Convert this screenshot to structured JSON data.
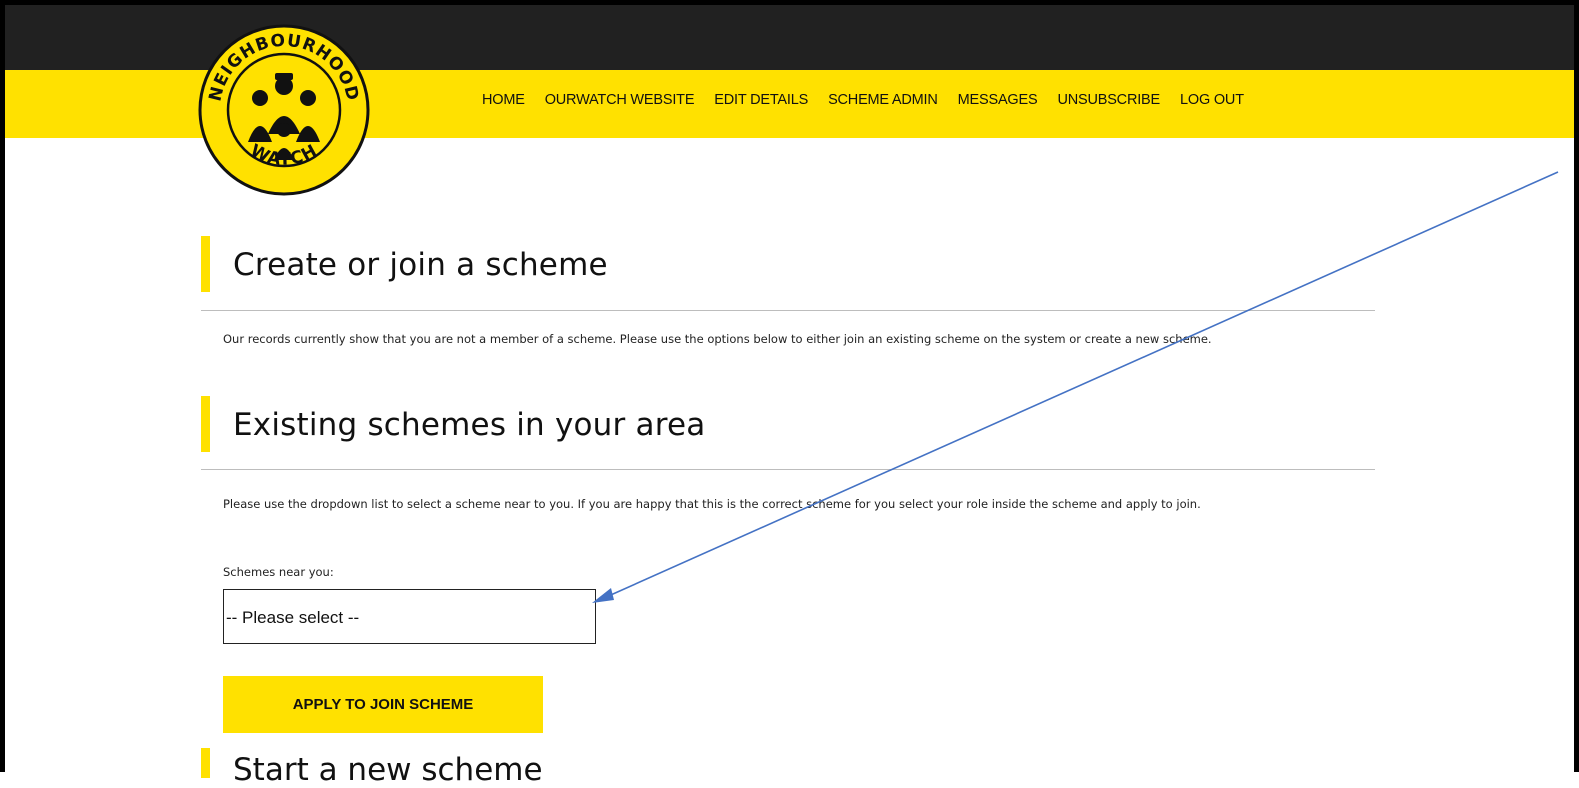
{
  "logo": {
    "ring_top": "NEIGHBOURHOOD",
    "ring_bottom": "WATCH"
  },
  "nav": {
    "items": [
      "HOME",
      "OURWATCH WEBSITE",
      "EDIT DETAILS",
      "SCHEME ADMIN",
      "MESSAGES",
      "UNSUBSCRIBE",
      "LOG OUT"
    ]
  },
  "create_section": {
    "heading": "Create or join a scheme",
    "intro": "Our records currently show that you are not a member of a scheme. Please use the options below to either join an existing scheme on the system or create a new scheme."
  },
  "existing_section": {
    "heading": "Existing schemes in your area",
    "intro": "Please use the dropdown list to select a scheme near to you. If you are happy that this is the correct scheme for you select your role inside the scheme and apply to join.",
    "select_label": "Schemes near you:",
    "select_value": "-- Please select --",
    "apply_button": "APPLY TO JOIN SCHEME"
  },
  "next_section": {
    "heading": "Start a new scheme"
  },
  "colors": {
    "brand_yellow": "#ffe100",
    "top_bar": "#212121",
    "annotation_arrow": "#4472c4"
  }
}
